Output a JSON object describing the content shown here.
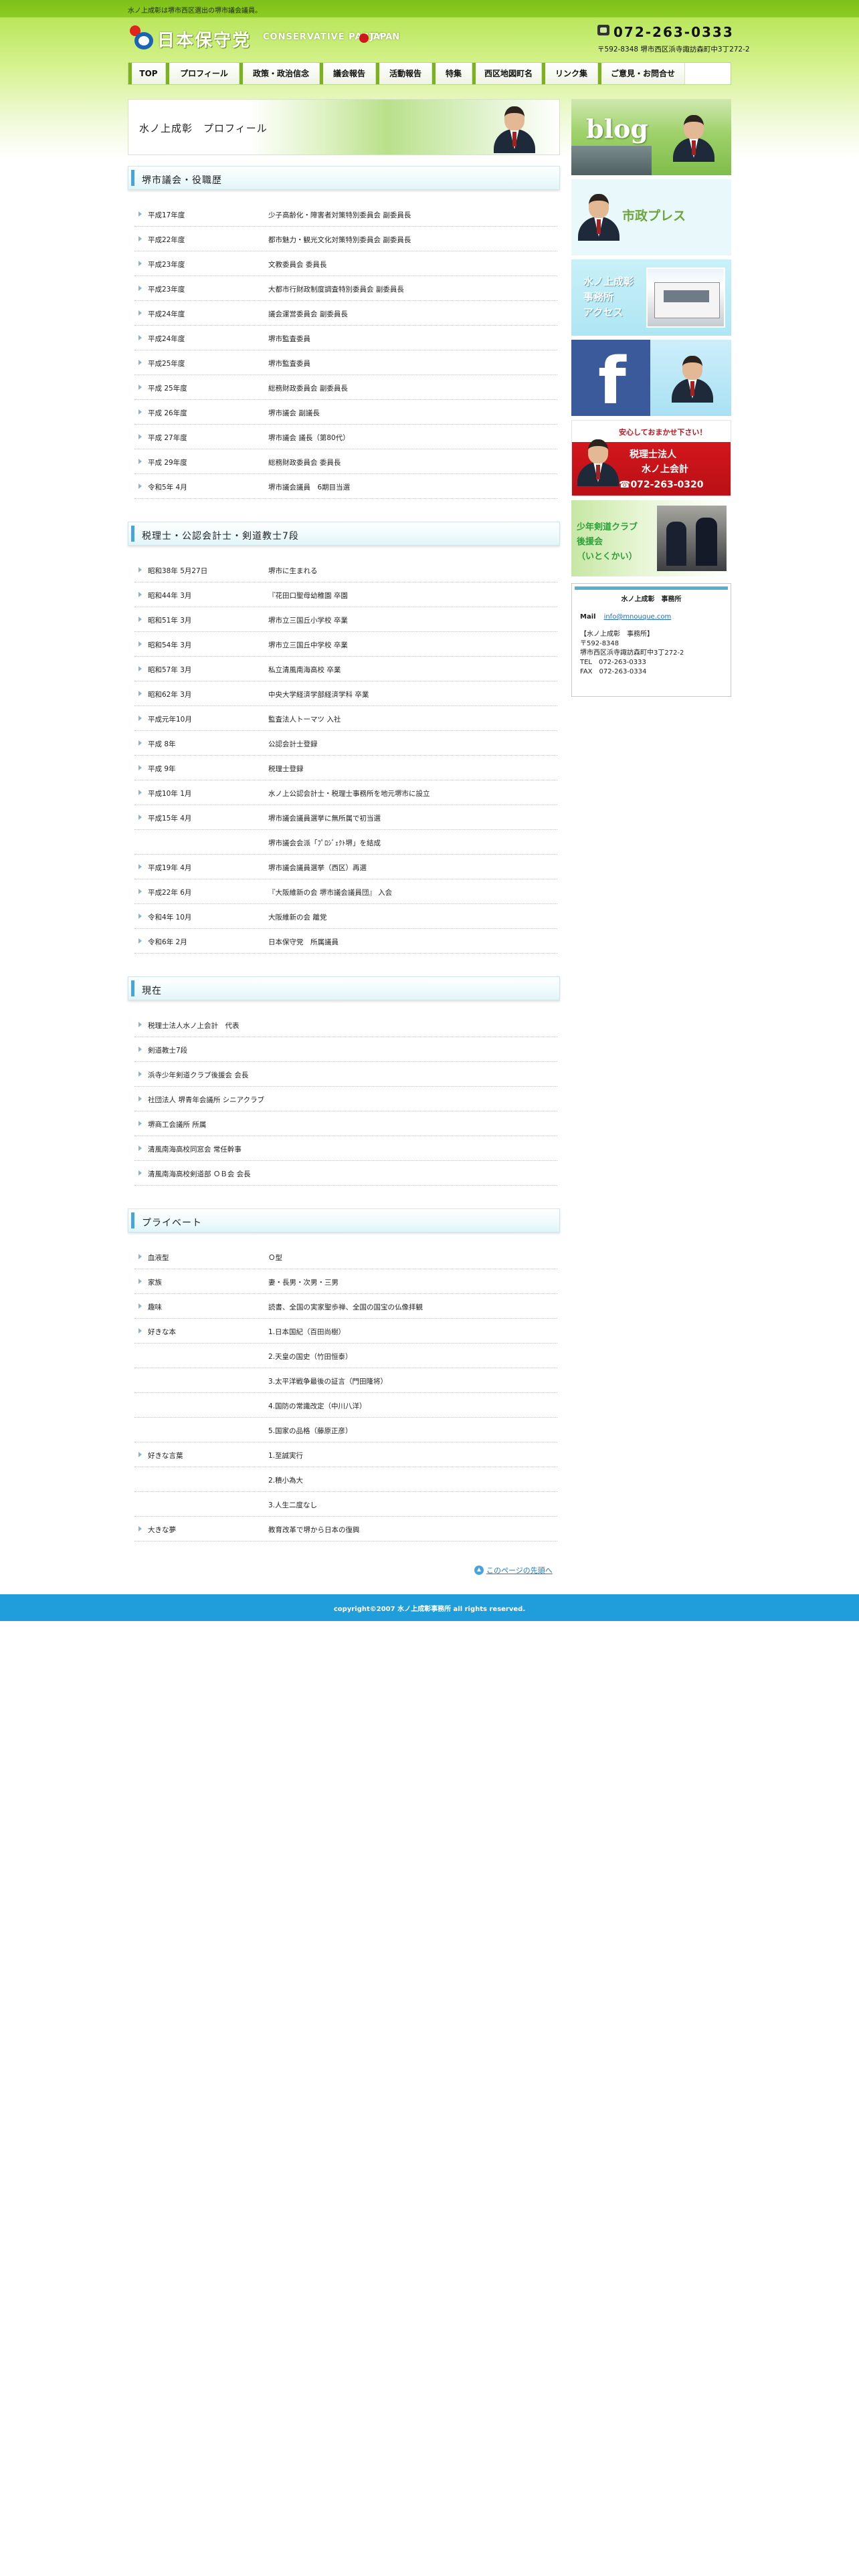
{
  "tagline": "水ノ上成彰は堺市西区選出の堺市議会議員。",
  "logo": {
    "jp": "日本保守党",
    "en": "CONSERVATIVE PARTY",
    "en2": "JAPAN"
  },
  "contact": {
    "phone": "072-263-0333",
    "address": "〒592-8348 堺市西区浜寺諏訪森町中3丁272-2"
  },
  "nav": [
    {
      "label": "TOP"
    },
    {
      "label": "プロフィール"
    },
    {
      "label": "政策・政治信念"
    },
    {
      "label": "議会報告"
    },
    {
      "label": "活動報告"
    },
    {
      "label": "特集"
    },
    {
      "label": "西区地図町名"
    },
    {
      "label": "リンク集"
    },
    {
      "label": "ご意見・お問合せ"
    }
  ],
  "hero": {
    "title": "水ノ上成彰　プロフィール"
  },
  "sections": [
    {
      "title": "堺市議会・役職歴",
      "rows": [
        [
          "平成17年度",
          "少子高齢化・障害者対策特別委員会 副委員長"
        ],
        [
          "平成22年度",
          "都市魅力・観光文化対策特別委員会 副委員長"
        ],
        [
          "平成23年度",
          "文教委員会 委員長"
        ],
        [
          "平成23年度",
          "大都市行財政制度調査特別委員会 副委員長"
        ],
        [
          "平成24年度",
          "議会運営委員会 副委員長"
        ],
        [
          "平成24年度",
          "堺市監査委員"
        ],
        [
          "平成25年度",
          "堺市監査委員"
        ],
        [
          "平成 25年度",
          "総務財政委員会 副委員長"
        ],
        [
          "平成 26年度",
          "堺市議会 副議長"
        ],
        [
          "平成 27年度",
          "堺市議会 議長（第80代）"
        ],
        [
          "平成 29年度",
          "総務財政委員会 委員長"
        ],
        [
          "令和5年 4月",
          "堺市議会議員　6期目当選"
        ]
      ]
    },
    {
      "title": "税理士・公認会計士・剣道教士7段",
      "rows": [
        [
          "昭和38年 5月27日",
          "堺市に生まれる"
        ],
        [
          "昭和44年 3月",
          "『花田口聖母幼稚園 卒園"
        ],
        [
          "昭和51年 3月",
          "堺市立三国丘小学校 卒業"
        ],
        [
          "昭和54年 3月",
          "堺市立三国丘中学校 卒業"
        ],
        [
          "昭和57年 3月",
          "私立清風南海高校 卒業"
        ],
        [
          "昭和62年 3月",
          "中央大学経済学部経済学科 卒業"
        ],
        [
          "平成元年10月",
          "監査法人トーマツ 入社"
        ],
        [
          "平成 8年",
          "公認会計士登録"
        ],
        [
          "平成 9年",
          "税理士登録"
        ],
        [
          "平成10年 1月",
          "水ノ上公認会計士・税理士事務所を地元堺市に設立"
        ],
        [
          "平成15年 4月",
          "堺市議会議員選挙に無所属で初当選"
        ],
        [
          "",
          "堺市議会会派「ﾌﾟﾛｼﾞｪｸﾄ堺」を結成"
        ],
        [
          "平成19年 4月",
          "堺市議会議員選挙（西区）再選"
        ],
        [
          "平成22年 6月",
          "『大阪維新の会 堺市議会議員団』 入会"
        ],
        [
          "令和4年 10月",
          "大阪維新の会 離党"
        ],
        [
          "令和6年 2月",
          "日本保守党　所属議員"
        ]
      ]
    },
    {
      "title": "現在",
      "rows": [
        [
          "税理士法人水ノ上会計　代表",
          ""
        ],
        [
          "剣道教士7段",
          ""
        ],
        [
          "浜寺少年剣道クラブ後援会 会長",
          ""
        ],
        [
          "社団法人 堺青年会議所 シニアクラブ",
          ""
        ],
        [
          "堺商工会議所 所属",
          ""
        ],
        [
          "清風南海高校同窓会 常任幹事",
          ""
        ],
        [
          "清風南海高校剣道部 ＯＢ会 会長",
          ""
        ]
      ]
    },
    {
      "title": "プライベート",
      "rows": [
        [
          "血液型",
          "Ｏ型"
        ],
        [
          "家族",
          "妻・長男・次男・三男"
        ],
        [
          "趣味",
          "読書、全国の実家聖歩禅、全国の国宝の仏像拝観"
        ],
        [
          "好きな本",
          "1.日本国紀（百田尚樹）"
        ],
        [
          "",
          "2.天皇の国史（竹田恒泰）"
        ],
        [
          "",
          "3.太平洋戦争最後の証言（門田隆将）"
        ],
        [
          "",
          "4.国防の常識改定（中川八洋）"
        ],
        [
          "",
          "5.国家の品格（藤原正彦）"
        ],
        [
          "好きな言葉",
          "1.至誠実行"
        ],
        [
          "",
          "2.積小為大"
        ],
        [
          "",
          "3.人生二度なし"
        ],
        [
          "大きな夢",
          "教育改革で堺から日本の復興"
        ]
      ]
    }
  ],
  "pagetop": "このページの先頭へ",
  "sidebar": {
    "blog": "blog",
    "press": "市政プレス",
    "access": [
      "水ノ上成彰",
      "事務所",
      "アクセス"
    ],
    "facebook": "f",
    "tax": {
      "top": "安心しておまかせ下さい！",
      "line1": "税理士法人",
      "line2": "水ノ上会計",
      "tel": "☎072-263-0320"
    },
    "kendo": [
      "少年剣道クラブ",
      "後援会",
      "（いとくかい）"
    ]
  },
  "office": {
    "head": "水ノ上成彰　事務所",
    "mail_label": "Mail",
    "mail": "info@mnouque.com",
    "lines": [
      "【水ノ上成彰　事務所】",
      "〒592-8348",
      "堺市西区浜寺諏訪森町中3丁272-2",
      "TEL　072-263-0333",
      "FAX　072-263-0334"
    ]
  },
  "footer": "copyright©2007 水ノ上成彰事務所 all rights reserved.",
  "colors": {
    "brand_green": "#7cb31c",
    "heading_accent": "#49a5d6",
    "footer_blue": "#1f9edb"
  }
}
